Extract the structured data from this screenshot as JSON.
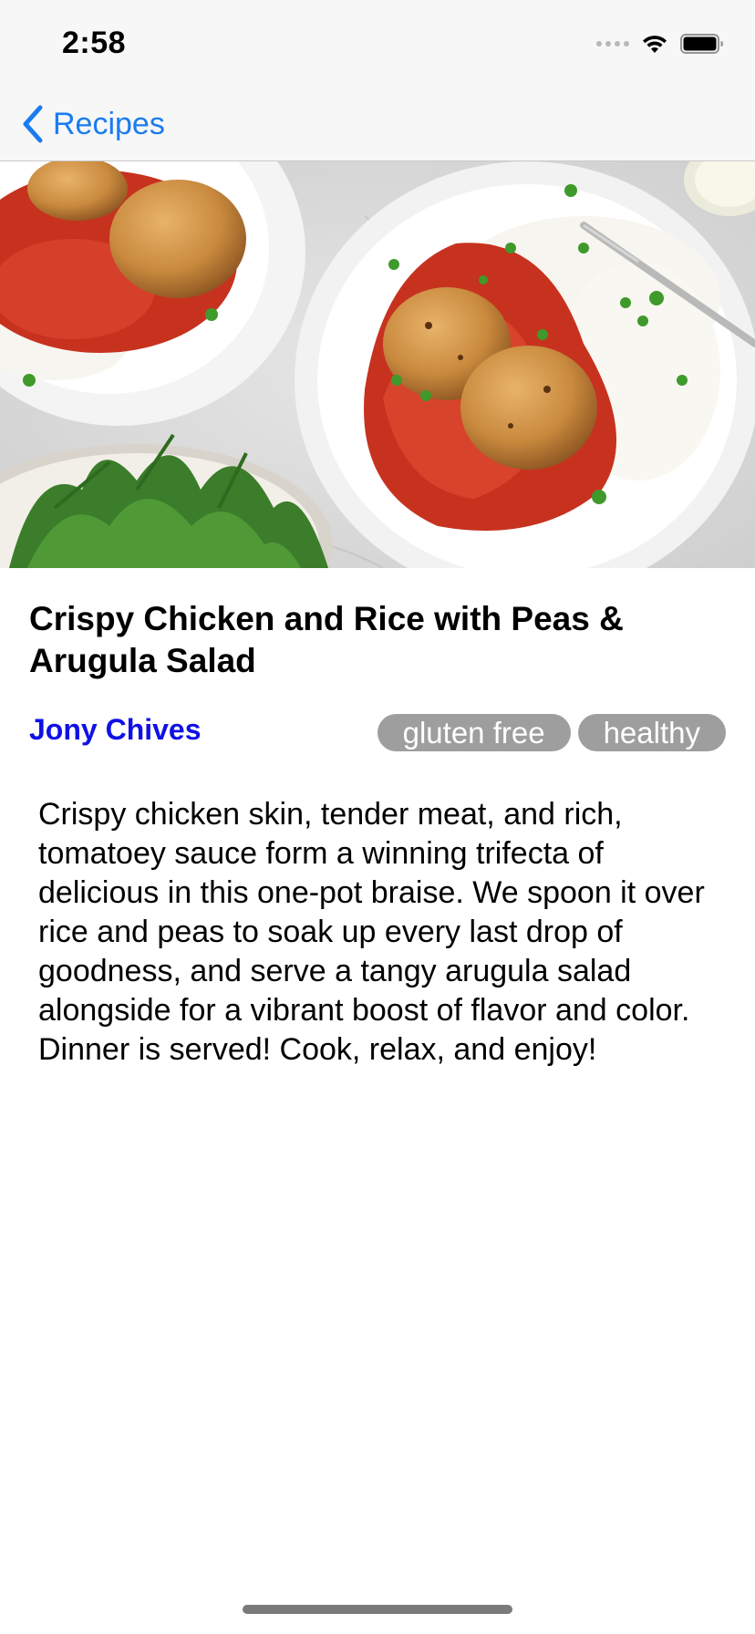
{
  "status_bar": {
    "time": "2:58",
    "icons": [
      "signal-dots-icon",
      "wifi-icon",
      "battery-icon"
    ]
  },
  "nav": {
    "back_label": "Recipes",
    "accent_color": "#1a7cf0"
  },
  "recipe": {
    "title": "Crispy Chicken and Rice with Peas & Arugula Salad",
    "author": "Jony Chives",
    "author_color": "#1010e6",
    "tags": [
      {
        "label": "gluten free"
      },
      {
        "label": "healthy"
      }
    ],
    "tag_color": "#9e9e9e",
    "description": "Crispy chicken skin, tender meat, and rich, tomatoey sauce form a winning trifecta of delicious in this one-pot braise. We spoon it over rice and peas to soak up every last drop of goodness, and serve a tangy arugula salad alongside for a vibrant boost of flavor and color. Dinner is served! Cook, relax, and enjoy!"
  }
}
